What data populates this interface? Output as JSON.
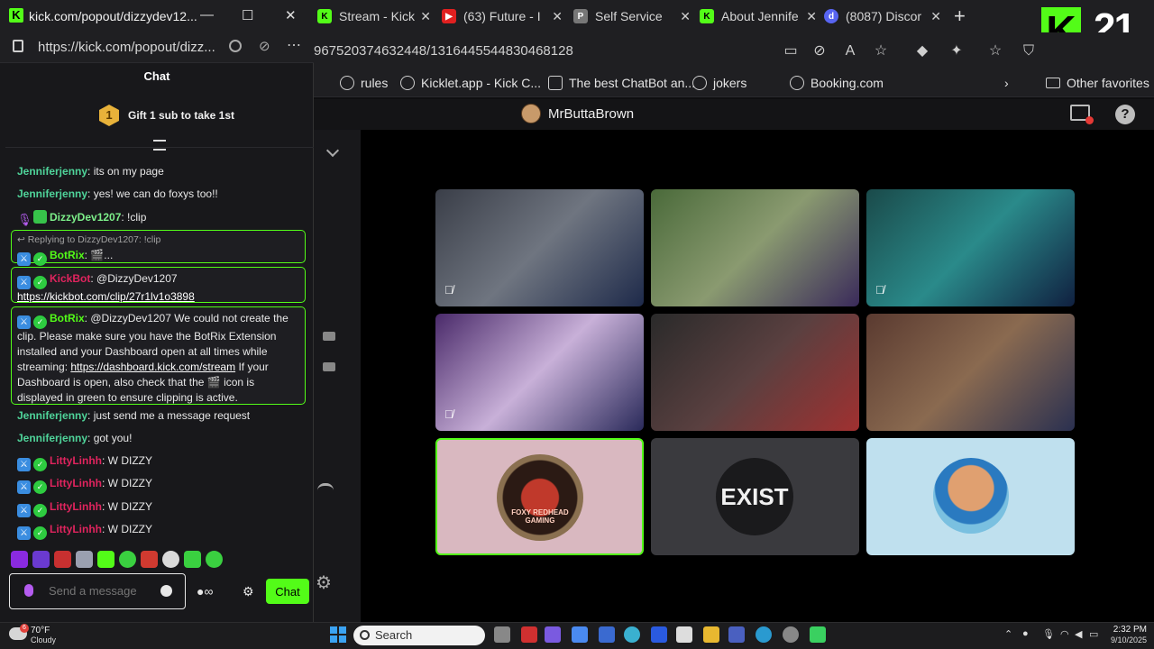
{
  "browser": {
    "tabs": [
      {
        "label": "Stream - Kick",
        "icon": "kick-icon",
        "color": "#53fc18"
      },
      {
        "label": "(63) Future - I",
        "icon": "youtube-icon",
        "color": "#e02020"
      },
      {
        "label": "Self Service",
        "icon": "page-icon",
        "color": "#777777"
      },
      {
        "label": "About Jennife",
        "icon": "kick-icon",
        "color": "#53fc18"
      },
      {
        "label": "(8087) Discor",
        "icon": "discord-icon",
        "color": "#5865f2"
      }
    ],
    "address": "967520374632448/1316445544830468128",
    "bookmarks": [
      "rules",
      "Kicklet.app - Kick C...",
      "The best ChatBot an...",
      "jokers",
      "Booking.com"
    ],
    "other_favorites": "Other favorites",
    "overlay_counter": "21",
    "overlay_logo": "K"
  },
  "stream": {
    "streamer_name": "MrButtaBrown",
    "tiles": [
      {
        "label": "participant-1",
        "colors": [
          "#3a3e48",
          "#6f7580",
          "#1e2a4a"
        ],
        "muted": true
      },
      {
        "label": "participant-2",
        "colors": [
          "#4a6a3a",
          "#8a9a70",
          "#3a2a5a"
        ],
        "muted": false
      },
      {
        "label": "participant-3",
        "colors": [
          "#1a4a4a",
          "#2a8a8a",
          "#102040"
        ],
        "muted": true
      },
      {
        "label": "participant-4",
        "colors": [
          "#4a2a6a",
          "#c8b0d8",
          "#2a2a5a"
        ],
        "muted": true
      },
      {
        "label": "participant-5",
        "colors": [
          "#2a2a2a",
          "#5a4040",
          "#a03030"
        ],
        "muted": false
      },
      {
        "label": "participant-6",
        "colors": [
          "#5a3a30",
          "#8a6a50",
          "#2a3050"
        ],
        "muted": false
      },
      {
        "label": "FOXY REDHEAD GAMING",
        "colors": [
          "#d9b8c0"
        ],
        "muted": false,
        "active": true
      },
      {
        "label": "EXIST",
        "colors": [
          "#3a3a3e"
        ],
        "muted": false
      },
      {
        "label": "participant-9",
        "colors": [
          "#bfe0ee"
        ],
        "muted": false
      }
    ]
  },
  "popout": {
    "title": "kick.com/popout/dizzydev12...",
    "url": "https://kick.com/popout/dizz...",
    "chat_header": "Chat",
    "gift_rank": "1",
    "gift_text": "Gift 1 sub to take 1st",
    "messages": [
      {
        "user": "Jenniferjenny",
        "text": ": its on my page"
      },
      {
        "user": "Jenniferjenny",
        "text": ": yes! we can do foxys too!!"
      },
      {
        "user": "DizzyDev1207",
        "text": ": !clip"
      },
      {
        "user": "Jenniferjenny",
        "text": ": just send me a message request"
      },
      {
        "user": "Jenniferjenny",
        "text": ": got you!"
      },
      {
        "user": "LittyLinhh",
        "text": ": W DIZZY"
      },
      {
        "user": "LittyLinhh",
        "text": ": W DIZZY"
      },
      {
        "user": "LittyLinhh",
        "text": ": W DIZZY"
      },
      {
        "user": "LittyLinhh",
        "text": ": W DIZZY"
      }
    ],
    "reply": {
      "replying_to": "Replying to DizzyDev1207: !clip",
      "user": "BotRix",
      "text": ": 🎬..."
    },
    "kickbot": {
      "user": "KickBot",
      "text": ": @DizzyDev1207",
      "link": "https://kickbot.com/clip/27r1lv1o3898"
    },
    "botrix": {
      "user": "BotRix",
      "text1": ": @DizzyDev1207 We could not create the clip. Please make sure you have the BotRix Extension installed and your Dashboard open at all times while streaming: ",
      "link": "https://dashboard.kick.com/stream",
      "text2": " If your Dashboard is open, also check that the 🎬 icon is displayed in green to ensure clipping is active."
    },
    "input_placeholder": "Send a message",
    "send_label": "Chat"
  },
  "taskbar": {
    "weather_temp": "70°F",
    "weather_cond": "Cloudy",
    "weather_badge": "6",
    "search_label": "Search",
    "time": "2:32 PM",
    "date": "9/10/2025"
  }
}
